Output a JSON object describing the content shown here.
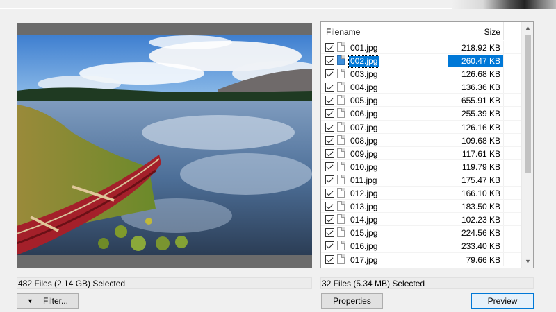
{
  "preview": {
    "status": "482 Files (2.14 GB) Selected",
    "filter_button": "Filter...",
    "filter_icon": "triangle-down-icon"
  },
  "file_list": {
    "columns": {
      "name": "Filename",
      "size": "Size"
    },
    "selected_index": 1,
    "rows": [
      {
        "name": "001.jpg",
        "size": "218.92 KB",
        "checked": true
      },
      {
        "name": "002.jpg",
        "size": "260.47 KB",
        "checked": true
      },
      {
        "name": "003.jpg",
        "size": "126.68 KB",
        "checked": true
      },
      {
        "name": "004.jpg",
        "size": "136.36 KB",
        "checked": true
      },
      {
        "name": "005.jpg",
        "size": "655.91 KB",
        "checked": true
      },
      {
        "name": "006.jpg",
        "size": "255.39 KB",
        "checked": true
      },
      {
        "name": "007.jpg",
        "size": "126.16 KB",
        "checked": true
      },
      {
        "name": "008.jpg",
        "size": "109.68 KB",
        "checked": true
      },
      {
        "name": "009.jpg",
        "size": "117.61 KB",
        "checked": true
      },
      {
        "name": "010.jpg",
        "size": "119.79 KB",
        "checked": true
      },
      {
        "name": "011.jpg",
        "size": "175.47 KB",
        "checked": true
      },
      {
        "name": "012.jpg",
        "size": "166.10 KB",
        "checked": true
      },
      {
        "name": "013.jpg",
        "size": "183.50 KB",
        "checked": true
      },
      {
        "name": "014.jpg",
        "size": "102.23 KB",
        "checked": true
      },
      {
        "name": "015.jpg",
        "size": "224.56 KB",
        "checked": true
      },
      {
        "name": "016.jpg",
        "size": "233.40 KB",
        "checked": true
      },
      {
        "name": "017.jpg",
        "size": "79.66 KB",
        "checked": true
      }
    ],
    "status": "32 Files (5.34 MB) Selected",
    "properties_button": "Properties",
    "preview_button": "Preview"
  },
  "colors": {
    "selection": "#0078d7",
    "window_bg": "#f0f0f0",
    "preview_frame": "#6b6b6b"
  }
}
